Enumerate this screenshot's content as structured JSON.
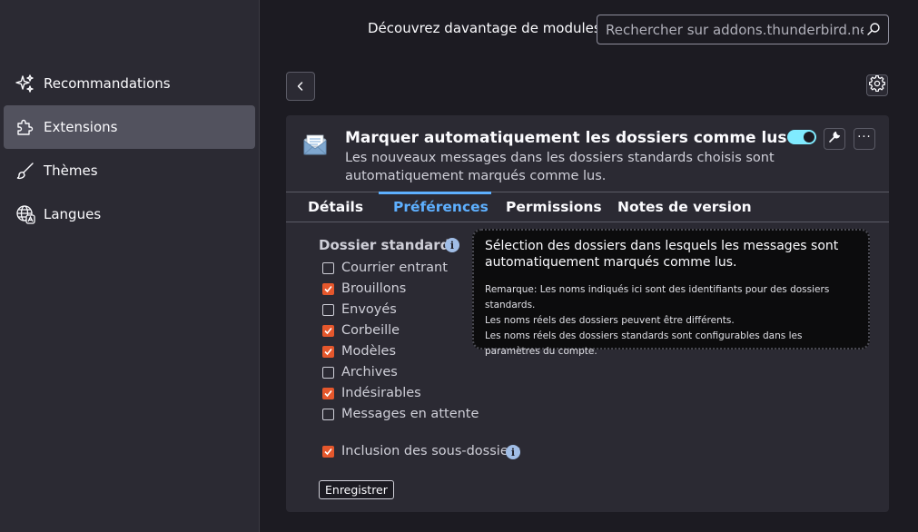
{
  "sidebar": {
    "items": [
      {
        "label": "Recommandations",
        "icon": "sparkle-icon"
      },
      {
        "label": "Extensions",
        "icon": "puzzle-icon",
        "active": true
      },
      {
        "label": "Thèmes",
        "icon": "brush-icon"
      },
      {
        "label": "Langues",
        "icon": "globe-language-icon"
      }
    ]
  },
  "header": {
    "discover_text": "Découvrez davantage de modules",
    "search_placeholder": "Rechercher sur addons.thunderbird.net"
  },
  "addon": {
    "name": "Marquer automatiquement les dossiers comme lus",
    "description": "Les nouveaux messages dans les dossiers standards choisis sont automatiquement marqués comme lus.",
    "enabled": true,
    "more_label": "···"
  },
  "tabs": [
    {
      "label": "Détails"
    },
    {
      "label": "Préférences",
      "active": true
    },
    {
      "label": "Permissions"
    },
    {
      "label": "Notes de version"
    }
  ],
  "prefs": {
    "title": "Dossier standard:",
    "info_glyph": "i",
    "folders": [
      {
        "label": "Courrier entrant",
        "checked": false
      },
      {
        "label": "Brouillons",
        "checked": true
      },
      {
        "label": "Envoyés",
        "checked": false
      },
      {
        "label": "Corbeille",
        "checked": true
      },
      {
        "label": "Modèles",
        "checked": true
      },
      {
        "label": "Archives",
        "checked": false
      },
      {
        "label": "Indésirables",
        "checked": true
      },
      {
        "label": "Messages en attente",
        "checked": false
      }
    ],
    "subfolders": {
      "label": "Inclusion des sous-dossiers",
      "checked": true
    },
    "save_label": "Enregistrer"
  },
  "tooltip": {
    "main": "Sélection des dossiers dans lesquels les messages sont automatiquement marqués comme lus.",
    "note_lines": [
      "Remarque: Les noms indiqués ici sont des identifiants pour des dossiers standards.",
      "Les noms réels des dossiers peuvent être différents.",
      "Les noms réels des dossiers standards sont configurables dans les paramètres du compte."
    ]
  },
  "colors": {
    "accent": "#5eb0ff",
    "checkbox": "#e5572c",
    "toggle": "#80ebff"
  }
}
